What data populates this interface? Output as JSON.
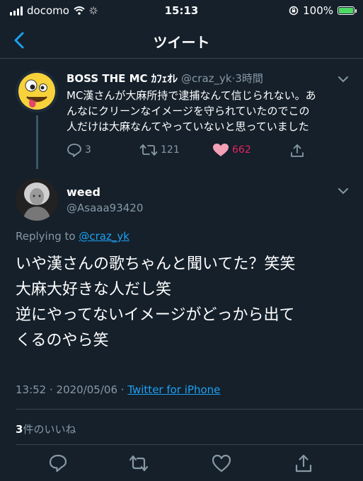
{
  "status_bar": {
    "carrier": "docomo",
    "time": "15:13",
    "battery": "100%"
  },
  "nav": {
    "title": "ツイート"
  },
  "tweet1": {
    "name": "BOSS THE MC ｶﾌｪｵﾚ",
    "handle": "@craz_yk",
    "separator": "·",
    "time": "3時間",
    "text_lines": [
      "MC漢さんが大麻所持で逮捕なんて信じられない。あ",
      "んなにクリーンなイメージを守られていたのでこの",
      "人だけは大麻なんてやっていないと思っていました"
    ],
    "replies": "3",
    "retweets": "121",
    "likes": "662",
    "colors": {
      "like": "#e0245e"
    }
  },
  "tweet2": {
    "name": "weed",
    "handle": "@Asaaa93420",
    "replying_prefix": "Replying to",
    "replying_to": "@craz_yk",
    "text_lines": [
      "いや漢さんの歌ちゃんと聞いてた？笑笑",
      "大麻大好きな人だし笑",
      "逆にやってないイメージがどっから出て",
      "くるのやら笑"
    ],
    "timestamp": "13:52 · 2020/05/06 ·",
    "source": "Twitter for iPhone",
    "like_count": "3",
    "like_label": "件のいいね"
  },
  "theme": {
    "background": "#15202b",
    "secondary_text": "#8899a6",
    "link": "#1da1f2",
    "divider": "#38444d"
  }
}
